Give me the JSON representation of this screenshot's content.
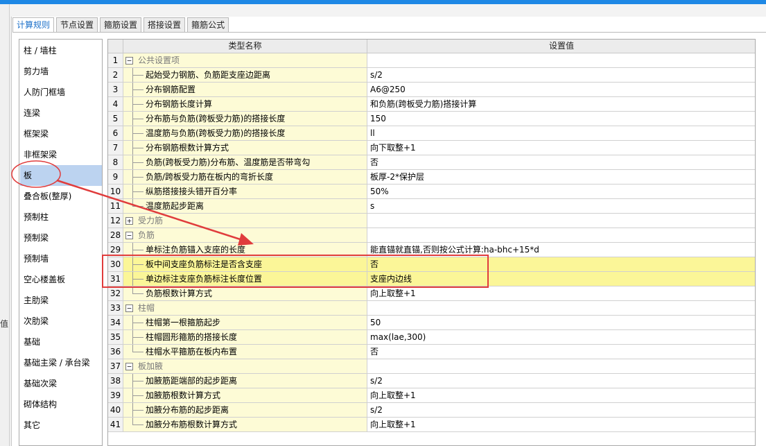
{
  "tabs": [
    {
      "label": "计算规则",
      "active": true
    },
    {
      "label": "节点设置",
      "active": false
    },
    {
      "label": "箍筋设置",
      "active": false
    },
    {
      "label": "搭接设置",
      "active": false
    },
    {
      "label": "箍筋公式",
      "active": false
    }
  ],
  "left_strip": [
    "值"
  ],
  "sidebar": [
    {
      "label": "柱 / 墙柱"
    },
    {
      "label": "剪力墙"
    },
    {
      "label": "人防门框墙"
    },
    {
      "label": "连梁"
    },
    {
      "label": "框架梁"
    },
    {
      "label": "非框架梁"
    },
    {
      "label": "板",
      "selected": true
    },
    {
      "label": "叠合板(整厚)"
    },
    {
      "label": "预制柱"
    },
    {
      "label": "预制梁"
    },
    {
      "label": "预制墙"
    },
    {
      "label": "空心楼盖板"
    },
    {
      "label": "主肋梁"
    },
    {
      "label": "次肋梁"
    },
    {
      "label": "基础"
    },
    {
      "label": "基础主梁 / 承台梁"
    },
    {
      "label": "基础次梁"
    },
    {
      "label": "砌体结构"
    },
    {
      "label": "其它"
    }
  ],
  "grid": {
    "headers": {
      "name": "类型名称",
      "value": "设置值"
    },
    "rows": [
      {
        "no": "1",
        "name": "公共设置项",
        "value": "",
        "group": true,
        "expander": "−"
      },
      {
        "no": "2",
        "name": "起始受力钢筋、负筋距支座边距离",
        "value": "s/2"
      },
      {
        "no": "3",
        "name": "分布钢筋配置",
        "value": "A6@250"
      },
      {
        "no": "4",
        "name": "分布钢筋长度计算",
        "value": "和负筋(跨板受力筋)搭接计算"
      },
      {
        "no": "5",
        "name": "分布筋与负筋(跨板受力筋)的搭接长度",
        "value": "150"
      },
      {
        "no": "6",
        "name": "温度筋与负筋(跨板受力筋)的搭接长度",
        "value": "ll"
      },
      {
        "no": "7",
        "name": "分布钢筋根数计算方式",
        "value": "向下取整+1"
      },
      {
        "no": "8",
        "name": "负筋(跨板受力筋)分布筋、温度筋是否带弯勾",
        "value": "否"
      },
      {
        "no": "9",
        "name": "负筋/跨板受力筋在板内的弯折长度",
        "value": "板厚-2*保护层"
      },
      {
        "no": "10",
        "name": "纵筋搭接接头错开百分率",
        "value": "50%"
      },
      {
        "no": "11",
        "name": "温度筋起步距离",
        "value": "s",
        "last": true
      },
      {
        "no": "12",
        "name": "受力筋",
        "value": "",
        "group": true,
        "expander": "+"
      },
      {
        "no": "28",
        "name": "负筋",
        "value": "",
        "group": true,
        "expander": "−"
      },
      {
        "no": "29",
        "name": "单标注负筋锚入支座的长度",
        "value": "能直锚就直锚,否则按公式计算:ha-bhc+15*d"
      },
      {
        "no": "30",
        "name": "板中间支座负筋标注是否含支座",
        "value": "否",
        "highlight": true
      },
      {
        "no": "31",
        "name": "单边标注支座负筋标注长度位置",
        "value": "支座内边线",
        "highlight": true
      },
      {
        "no": "32",
        "name": "负筋根数计算方式",
        "value": "向上取整+1",
        "last": true
      },
      {
        "no": "33",
        "name": "柱帽",
        "value": "",
        "group": true,
        "expander": "−"
      },
      {
        "no": "34",
        "name": "柱帽第一根箍筋起步",
        "value": "50"
      },
      {
        "no": "35",
        "name": "柱帽圆形箍筋的搭接长度",
        "value": "max(lae,300)"
      },
      {
        "no": "36",
        "name": "柱帽水平箍筋在板内布置",
        "value": "否",
        "last": true
      },
      {
        "no": "37",
        "name": "板加腋",
        "value": "",
        "group": true,
        "expander": "−"
      },
      {
        "no": "38",
        "name": "加腋筋距端部的起步距离",
        "value": "s/2"
      },
      {
        "no": "39",
        "name": "加腋筋根数计算方式",
        "value": "向上取整+1"
      },
      {
        "no": "40",
        "name": "加腋分布筋的起步距离",
        "value": "s/2"
      },
      {
        "no": "41",
        "name": "加腋分布筋根数计算方式",
        "value": "向上取整+1",
        "last": true
      }
    ]
  },
  "annotation_color": "#e03c3c"
}
